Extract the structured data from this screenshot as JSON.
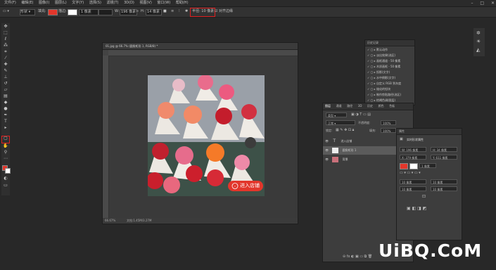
{
  "menu": [
    "文件(F)",
    "编辑(E)",
    "图像(I)",
    "图层(L)",
    "文字(Y)",
    "选择(S)",
    "滤镜(T)",
    "3D(D)",
    "视图(V)",
    "窗口(W)",
    "帮助(H)"
  ],
  "options": {
    "mode": "形状",
    "fill_label": "填充:",
    "stroke_label": "描边:",
    "stroke_width": "1 像素",
    "w_label": "W:",
    "w_value": "196 像素",
    "h_label": "H:",
    "h_value": "14 像素",
    "radius_value": "半径:  10 像素",
    "align_label": "对齐边缘",
    "accent_color": "#e2362b"
  },
  "document": {
    "tab_title": "01.jpg @ 66.7% (圆角矩形 1, RGB/8) *",
    "zoom": "66.67%",
    "doc_info": "文档:1.45M/3.27M",
    "photo_button_label": "进入店铺"
  },
  "history": {
    "tabs": [
      "历史记录"
    ],
    "snapshot": "默认动作",
    "items": [
      "淡出效果(选区)",
      "画框通道 - 50 像素",
      "木质画框 - 50 像素",
      "投影(文字)",
      "水中倒影(文字)",
      "自定义 RGB 到灰度",
      "熔化的铅块",
      "制作剪贴路径(选区)",
      "棕褐色调(图层)",
      "四分颜色"
    ]
  },
  "layers": {
    "tabs": [
      "图层",
      "通道",
      "路径",
      "3D",
      "历史",
      "颜色",
      "色板"
    ],
    "kind_label": "类型",
    "blend_mode": "正常",
    "opacity_label": "不透明度:",
    "opacity_value": "100%",
    "lock_label": "锁定:",
    "fill_label": "填充:",
    "fill_value": "100%",
    "items": [
      {
        "name": "进入店铺",
        "type": "text"
      },
      {
        "name": "圆角矩形 1",
        "type": "shape"
      },
      {
        "name": "背景",
        "type": "image"
      }
    ]
  },
  "properties": {
    "title": "属性",
    "subtitle": "实时形状属性",
    "w": "W: 196 像素",
    "h": "H: 34 像素",
    "x": "X: 379 像素",
    "y": "Y: 611 像素",
    "stroke_width": "1 像素",
    "corners": [
      "10 像素",
      "10 像素",
      "10 像素",
      "10 像素"
    ]
  },
  "watermark": "UiBQ.CoM"
}
